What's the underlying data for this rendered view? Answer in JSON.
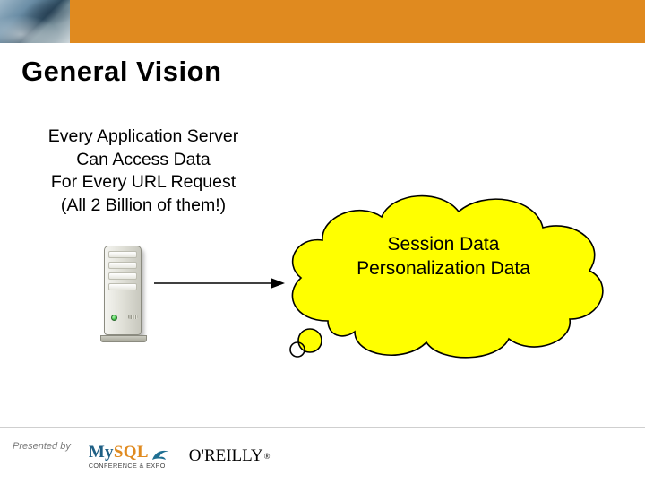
{
  "header": {
    "accent_color": "#e08a1f"
  },
  "title": "General Vision",
  "body": {
    "line1": "Every Application Server",
    "line2": "Can Access Data",
    "line3": "For Every URL Request",
    "line4": "(All 2 Billion of them!)"
  },
  "diagram": {
    "server_label": "application-server",
    "arrow_label": "connects-to",
    "cloud_fill": "#ffff00",
    "cloud_line1": "Session Data",
    "cloud_line2": "Personalization Data"
  },
  "footer": {
    "presented_by": "Presented by",
    "mysql_name": "MySQL",
    "mysql_tag": "CONFERENCE & EXPO",
    "oreilly_name": "O'REILLY",
    "oreilly_mark": "®"
  }
}
